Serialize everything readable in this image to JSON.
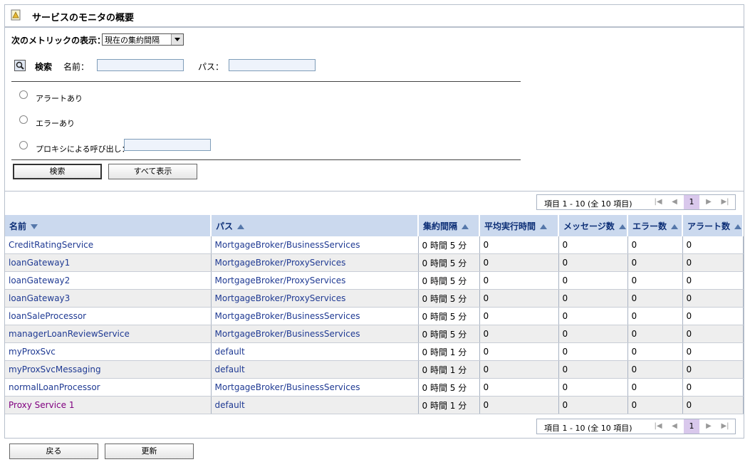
{
  "header": {
    "title": "サービスのモニタの概要"
  },
  "filter": {
    "metric_label": "次のメトリックの表示：",
    "metric_value": "現在の集約間隔",
    "search_label": "検索",
    "name_label": "名前：",
    "path_label": "パス：",
    "opt_alert": "アラートあり",
    "opt_error": "エラーあり",
    "opt_proxy": "プロキシによる呼び出し：",
    "search_button": "検索",
    "show_all_button": "すべて表示"
  },
  "pager": {
    "info": "項目 1 - 10 (全 10 項目)",
    "current": "1"
  },
  "table": {
    "headers": [
      "名前",
      "パス",
      "集約間隔",
      "平均実行時間",
      "メッセージ数",
      "エラー数",
      "アラート数"
    ],
    "rows": [
      [
        "CreditRatingService",
        "MortgageBroker/BusinessServices",
        "0 時間 5 分",
        "0",
        "0",
        "0",
        "0"
      ],
      [
        "loanGateway1",
        "MortgageBroker/ProxyServices",
        "0 時間 5 分",
        "0",
        "0",
        "0",
        "0"
      ],
      [
        "loanGateway2",
        "MortgageBroker/ProxyServices",
        "0 時間 5 分",
        "0",
        "0",
        "0",
        "0"
      ],
      [
        "loanGateway3",
        "MortgageBroker/ProxyServices",
        "0 時間 5 分",
        "0",
        "0",
        "0",
        "0"
      ],
      [
        "loanSaleProcessor",
        "MortgageBroker/BusinessServices",
        "0 時間 5 分",
        "0",
        "0",
        "0",
        "0"
      ],
      [
        "managerLoanReviewService",
        "MortgageBroker/BusinessServices",
        "0 時間 5 分",
        "0",
        "0",
        "0",
        "0"
      ],
      [
        "myProxSvc",
        "default",
        "0 時間 1 分",
        "0",
        "0",
        "0",
        "0"
      ],
      [
        "myProxSvcMessaging",
        "default",
        "0 時間 1 分",
        "0",
        "0",
        "0",
        "0"
      ],
      [
        "normalLoanProcessor",
        "MortgageBroker/BusinessServices",
        "0 時間 5 分",
        "0",
        "0",
        "0",
        "0"
      ],
      [
        "Proxy Service 1",
        "default",
        "0 時間 1 分",
        "0",
        "0",
        "0",
        "0"
      ]
    ]
  },
  "footer": {
    "back_button": "戻る",
    "refresh_button": "更新"
  }
}
